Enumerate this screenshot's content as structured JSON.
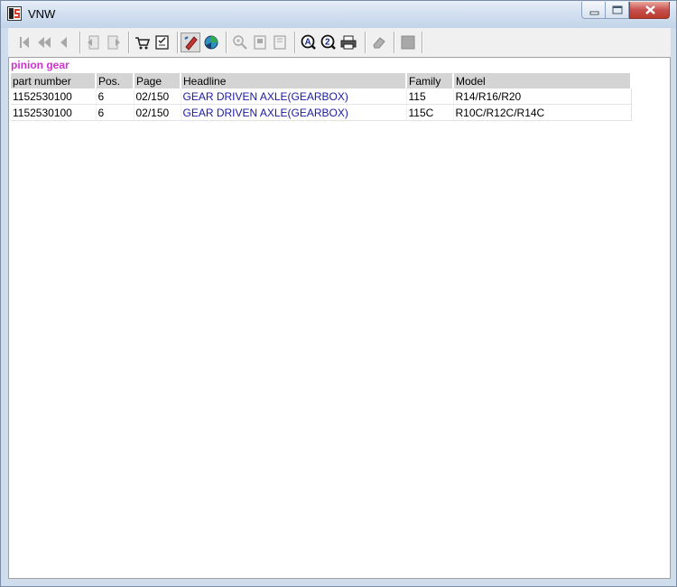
{
  "window": {
    "title": "VNW",
    "controls": [
      "minimize-icon",
      "maximize-icon",
      "close-icon"
    ]
  },
  "toolbar": {
    "buttons": [
      {
        "icon": "first-record-icon",
        "state": "disabled"
      },
      {
        "icon": "rewind-icon",
        "state": "disabled"
      },
      {
        "icon": "previous-icon",
        "state": "disabled"
      },
      {
        "icon": "back-page-icon",
        "state": "disabled"
      },
      {
        "icon": "forward-page-icon",
        "state": "disabled"
      },
      {
        "icon": "cart-icon",
        "state": "enabled"
      },
      {
        "icon": "checklist-icon",
        "state": "enabled"
      },
      {
        "icon": "pencil-search-icon",
        "state": "active"
      },
      {
        "icon": "globe-icon",
        "state": "enabled"
      },
      {
        "icon": "zoom-in-icon",
        "state": "disabled"
      },
      {
        "icon": "page-icon",
        "state": "disabled"
      },
      {
        "icon": "page-alt-icon",
        "state": "disabled"
      },
      {
        "icon": "search-a-icon",
        "state": "enabled"
      },
      {
        "icon": "search-2-icon",
        "state": "enabled"
      },
      {
        "icon": "print-icon",
        "state": "enabled"
      },
      {
        "icon": "eraser-icon",
        "state": "disabled"
      },
      {
        "icon": "stop-icon",
        "state": "disabled"
      }
    ]
  },
  "search": {
    "query": "pinion gear"
  },
  "results": {
    "columns": [
      "part number",
      "Pos.",
      "Page",
      "Headline",
      "Family",
      "Model"
    ],
    "rows": [
      [
        "1152530100",
        "6",
        "02/150",
        "GEAR DRIVEN AXLE(GEARBOX)",
        "115",
        "R14/R16/R20"
      ],
      [
        "1152530100",
        "6",
        "02/150",
        "GEAR DRIVEN AXLE(GEARBOX)",
        "115C",
        "R10C/R12C/R14C"
      ]
    ]
  },
  "colors": {
    "query_text": "#cc33cc",
    "headline_link": "#1a1aa6",
    "header_background": "#d4d4d4"
  }
}
